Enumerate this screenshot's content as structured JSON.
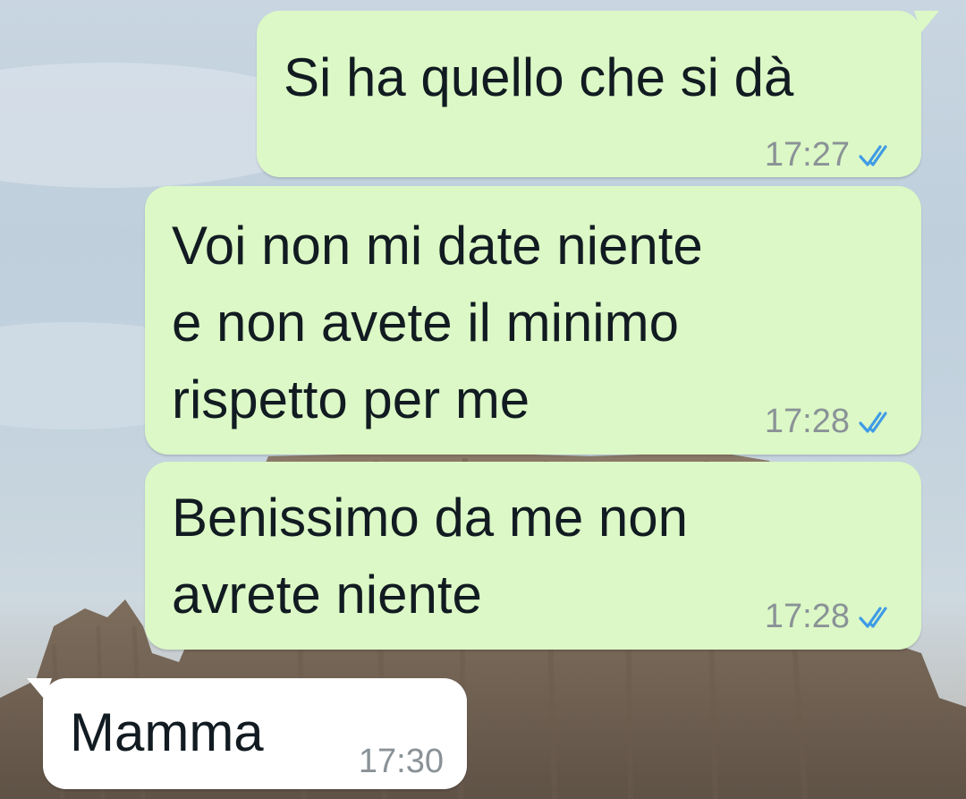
{
  "chat": {
    "messages": [
      {
        "direction": "outgoing",
        "text": "Si ha quello che si dà",
        "time": "17:27",
        "status": "read",
        "status_icon": "double-check-read-icon"
      },
      {
        "direction": "outgoing",
        "text": "Voi non mi date niente\ne non avete il minimo\nrispetto per me",
        "time": "17:28",
        "status": "read",
        "status_icon": "double-check-read-icon"
      },
      {
        "direction": "outgoing",
        "text": "Benissimo da me non\navrete niente",
        "time": "17:28",
        "status": "read",
        "status_icon": "double-check-read-icon"
      },
      {
        "direction": "incoming",
        "text": "Mamma",
        "time": "17:30"
      }
    ]
  },
  "colors": {
    "outgoing_bubble": "#dcf8c6",
    "incoming_bubble": "#ffffff",
    "text": "#111b21",
    "timestamp": "#8a9297",
    "read_ticks": "#3f9be6"
  }
}
